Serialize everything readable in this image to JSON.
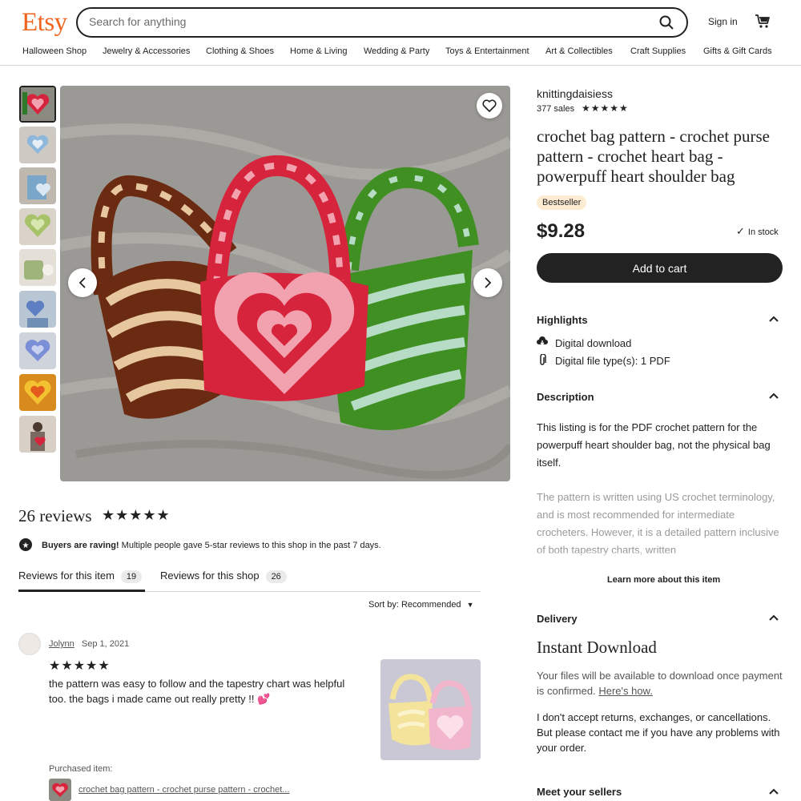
{
  "header": {
    "logo": "Etsy",
    "search_placeholder": "Search for anything",
    "sign_in": "Sign in"
  },
  "nav": {
    "categories": [
      "Halloween Shop",
      "Jewelry & Accessories",
      "Clothing & Shoes",
      "Home & Living",
      "Wedding & Party",
      "Toys & Entertainment",
      "Art & Collectibles",
      "Craft Supplies",
      "Gifts & Gift Cards"
    ]
  },
  "listing": {
    "shop_name": "knittingdaisiess",
    "sales": "377 sales",
    "rating_stars": "★★★★★",
    "title": "crochet bag pattern - crochet purse pattern - crochet heart bag - powerpuff heart shoulder bag",
    "badge": "Bestseller",
    "price": "$9.28",
    "stock": "In stock",
    "add_to_cart": "Add to cart"
  },
  "highlights": {
    "heading": "Highlights",
    "items": [
      "Digital download",
      "Digital file type(s): 1 PDF"
    ]
  },
  "description": {
    "heading": "Description",
    "para1": "This listing is for the PDF crochet pattern for the powerpuff heart shoulder bag, not the physical bag itself.",
    "para2": "The pattern is written using US crochet terminology, and is most recommended for intermediate crocheters. However, it is a detailed pattern inclusive of both tapestry charts, written",
    "learn_more": "Learn more about this item"
  },
  "delivery": {
    "heading": "Delivery",
    "title": "Instant Download",
    "text1": "Your files will be available to download once payment is confirmed.",
    "link": "Here's how.",
    "text2": "I don't accept returns, exchanges, or cancellations. But please contact me if you have any problems with your order."
  },
  "meet_sellers": "Meet your sellers",
  "reviews": {
    "title": "26 reviews",
    "stars": "★★★★★",
    "raving_bold": "Buyers are raving!",
    "raving_text": "Multiple people gave 5-star reviews to this shop in the past 7 days.",
    "tab_item": "Reviews for this item",
    "tab_item_count": "19",
    "tab_shop": "Reviews for this shop",
    "tab_shop_count": "26",
    "sort": "Sort by: Recommended",
    "review": {
      "name": "Jolynn",
      "date": "Sep 1, 2021",
      "stars": "★★★★★",
      "text": "the pattern was easy to follow and the tapestry chart was helpful too. the bags i made came out really pretty !! 💕",
      "purchased_label": "Purchased item:",
      "purchased_title": "crochet bag pattern - crochet purse pattern - crochet..."
    }
  },
  "colors": {
    "brand": "#F1641E",
    "badge_bg": "#FDEBD2",
    "button_bg": "#222222"
  }
}
